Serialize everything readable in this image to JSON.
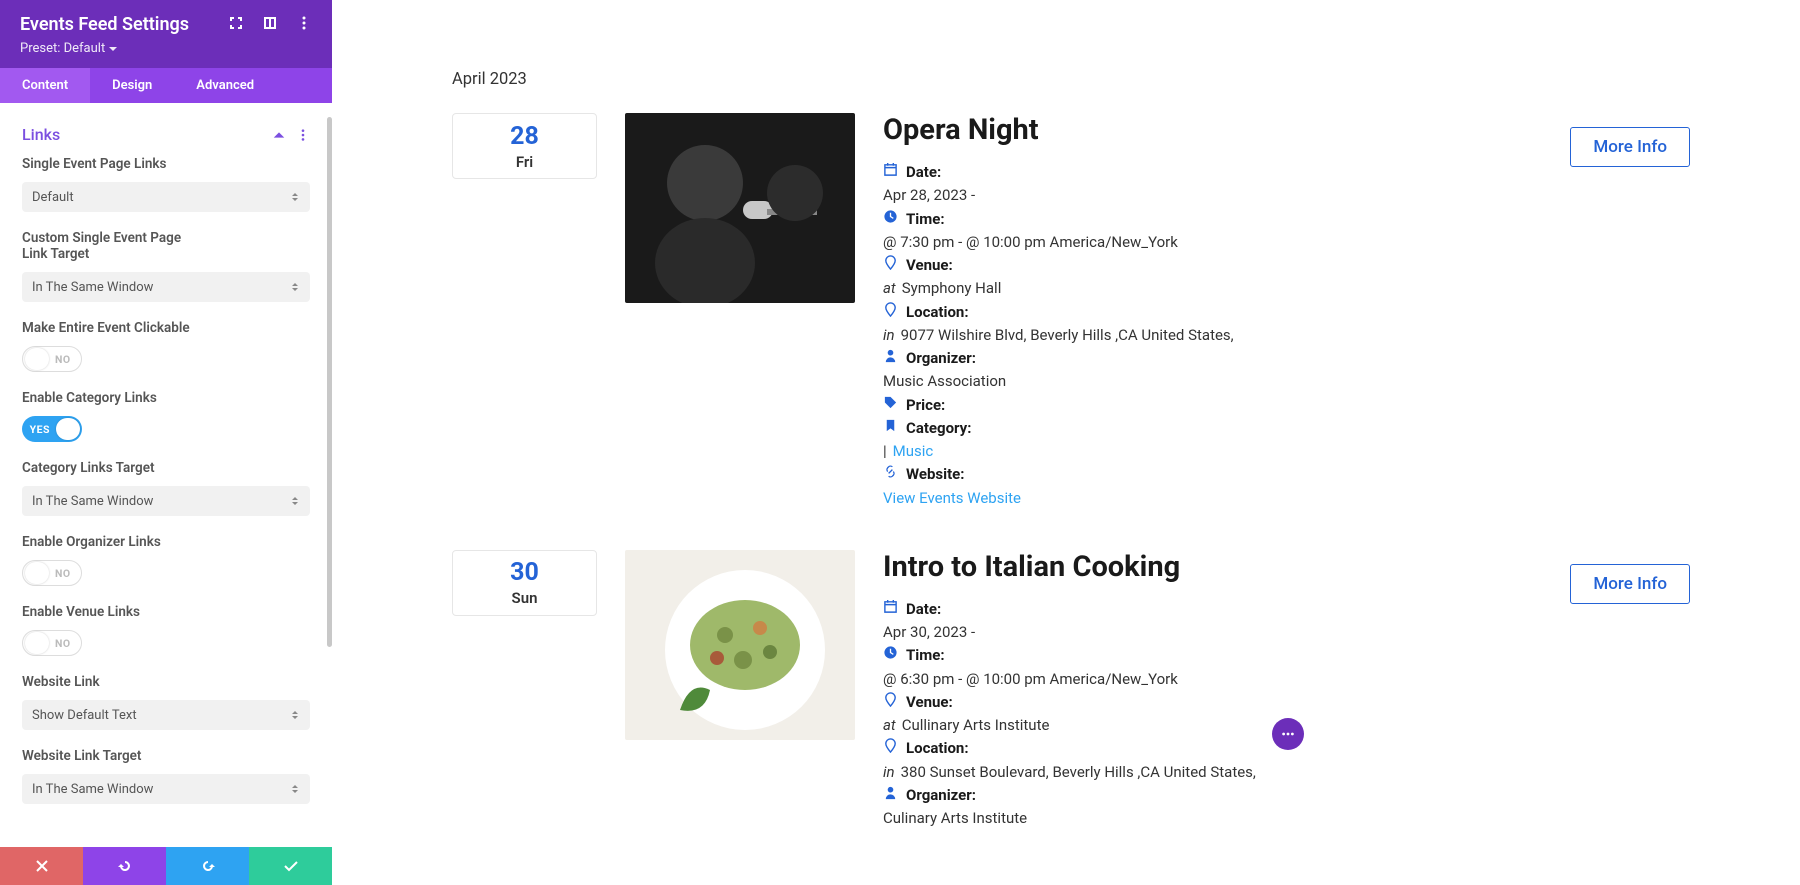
{
  "sidebar": {
    "title": "Events Feed Settings",
    "preset_label": "Preset: Default",
    "tabs": [
      {
        "label": "Content",
        "active": true
      },
      {
        "label": "Design",
        "active": false
      },
      {
        "label": "Advanced",
        "active": false
      }
    ],
    "section_title": "Links",
    "fields": {
      "single_event_page_links": {
        "label": "Single Event Page Links",
        "value": "Default"
      },
      "custom_link_target": {
        "label": "Custom Single Event Page Link Target",
        "value": "In The Same Window"
      },
      "make_entire_clickable": {
        "label": "Make Entire Event Clickable",
        "value": "NO"
      },
      "enable_category_links": {
        "label": "Enable Category Links",
        "value": "YES"
      },
      "category_links_target": {
        "label": "Category Links Target",
        "value": "In The Same Window"
      },
      "enable_organizer_links": {
        "label": "Enable Organizer Links",
        "value": "NO"
      },
      "enable_venue_links": {
        "label": "Enable Venue Links",
        "value": "NO"
      },
      "website_link": {
        "label": "Website Link",
        "value": "Show Default Text"
      },
      "website_link_target": {
        "label": "Website Link Target",
        "value": "In The Same Window"
      }
    }
  },
  "preview": {
    "month_heading": "April 2023",
    "more_info_label": "More Info",
    "meta_labels": {
      "date": "Date:",
      "time": "Time:",
      "venue": "Venue:",
      "location": "Location:",
      "organizer": "Organizer:",
      "price": "Price:",
      "category": "Category:",
      "website": "Website:"
    },
    "at_word": "at",
    "in_word": "in",
    "pipe": "|",
    "events": [
      {
        "day_num": "28",
        "day_name": "Fri",
        "title": "Opera Night",
        "date_value": "Apr 28, 2023  -",
        "time_value": "@ 7:30 pm - @ 10:00 pm America/New_York",
        "venue_value": "Symphony Hall",
        "location_value": "9077 Wilshire Blvd, Beverly Hills ,CA United States,",
        "organizer_value": "Music Association",
        "price_value": "",
        "category_value": "Music",
        "website_value": "View Events Website"
      },
      {
        "day_num": "30",
        "day_name": "Sun",
        "title": "Intro to Italian Cooking",
        "date_value": "Apr 30, 2023  -",
        "time_value": "@ 6:30 pm - @ 10:00 pm America/New_York",
        "venue_value": "Cullinary Arts Institute",
        "location_value": "380 Sunset Boulevard, Beverly Hills ,CA United States,",
        "organizer_value": "Organizer:",
        "organizer_extra": "Culinary Arts Institute"
      }
    ]
  },
  "colors": {
    "accent_purple": "#6c2eb9",
    "accent_blue": "#2463d6",
    "link_blue": "#2ea3f2"
  }
}
